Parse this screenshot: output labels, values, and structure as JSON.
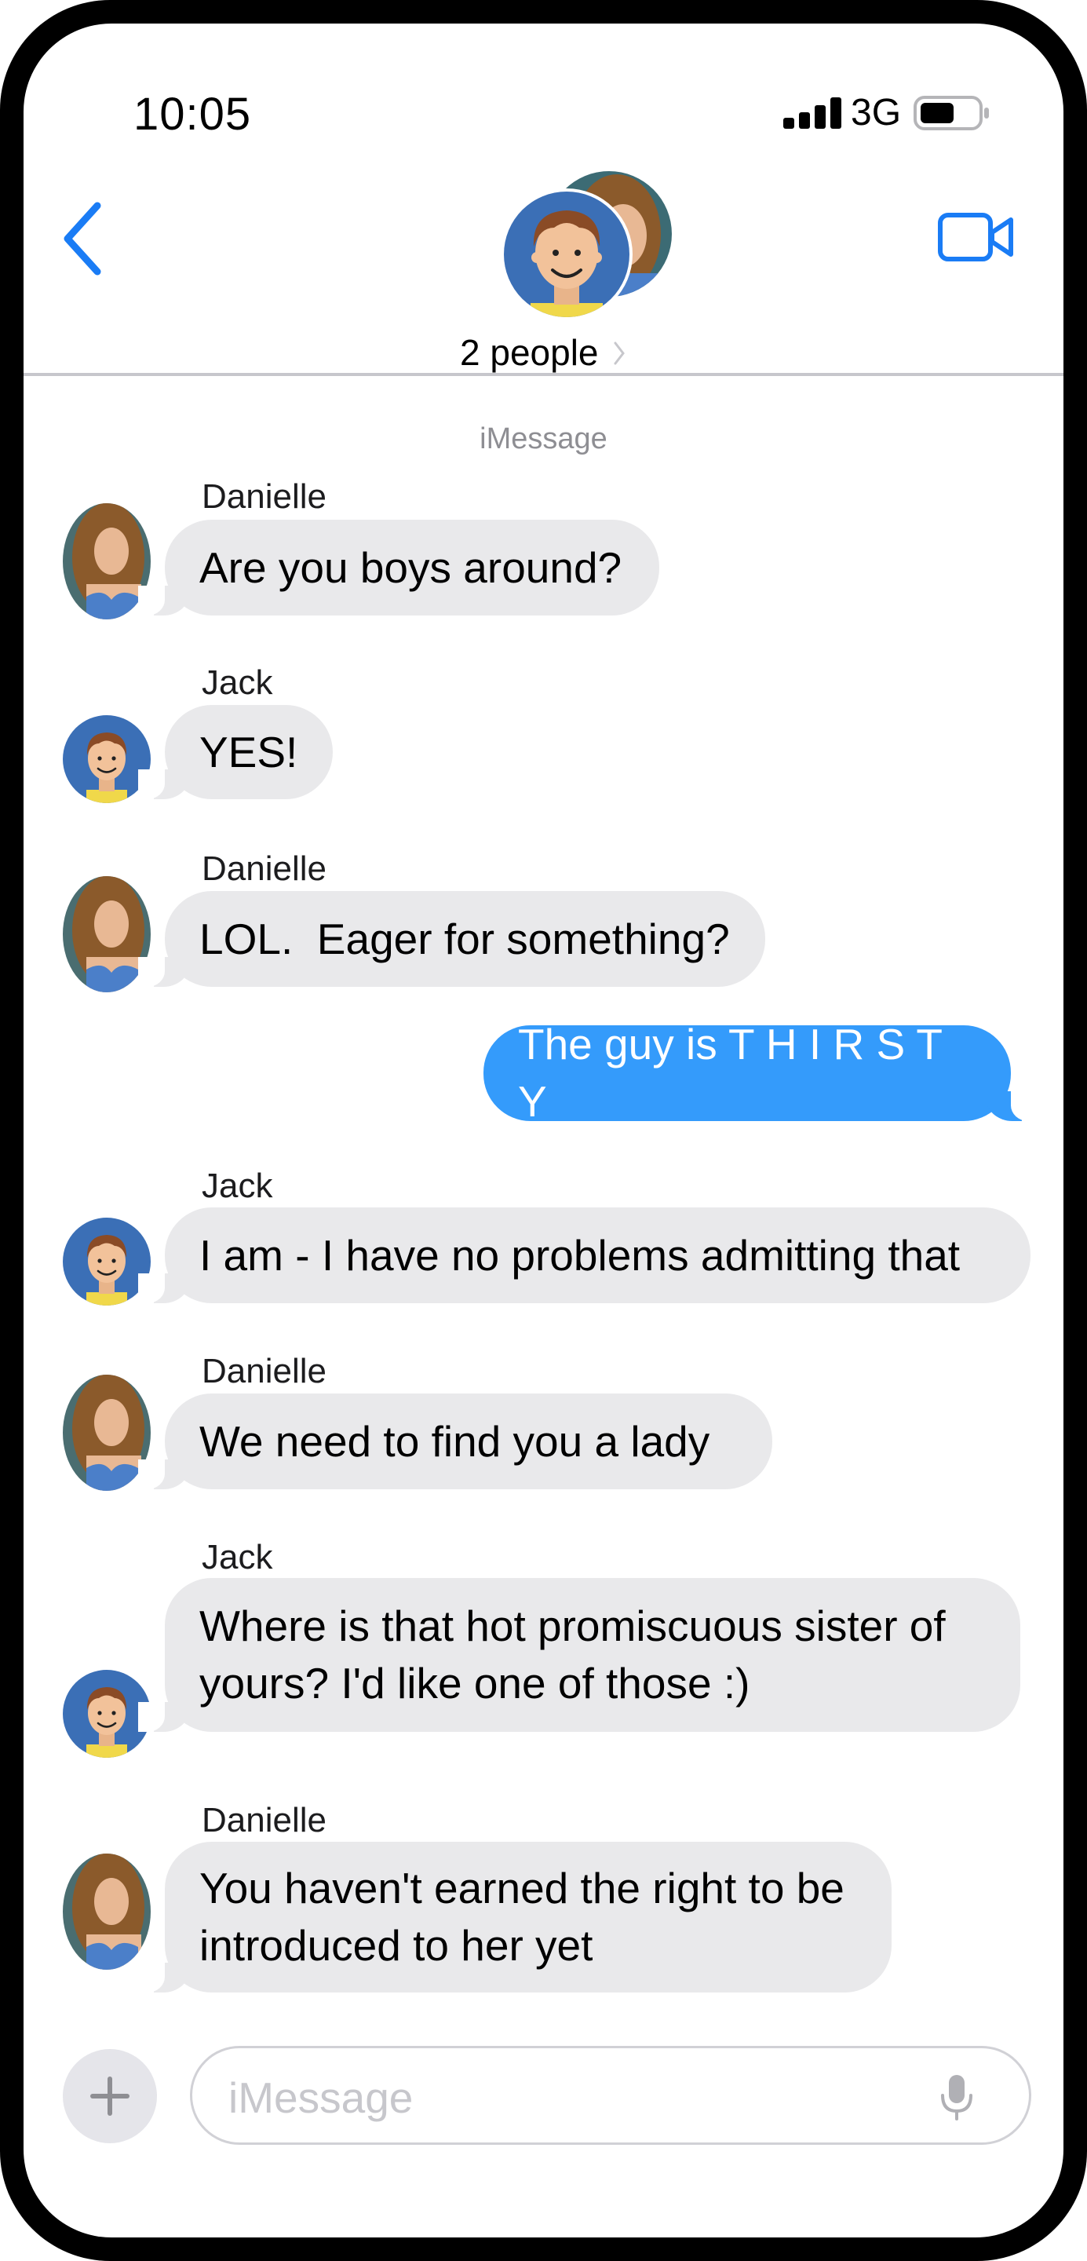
{
  "status_bar": {
    "time": "10:05",
    "carrier": "3G",
    "icons": [
      "signal-bars-icon",
      "battery-icon"
    ]
  },
  "header": {
    "participants_label": "2 people",
    "icons": [
      "back-chevron-icon",
      "video-camera-icon",
      "chevron-right-icon"
    ]
  },
  "conversation": {
    "service_label": "iMessage",
    "messages": [
      {
        "sender": "Danielle",
        "text": "Are you boys around?",
        "direction": "incoming"
      },
      {
        "sender": "Jack",
        "text": "YES!",
        "direction": "incoming"
      },
      {
        "sender": "Danielle",
        "text": "LOL.  Eager for something?",
        "direction": "incoming"
      },
      {
        "sender": "",
        "text": "The guy is T H I R S T Y",
        "direction": "outgoing"
      },
      {
        "sender": "Jack",
        "text": "I am - I have no problems admitting that",
        "direction": "incoming"
      },
      {
        "sender": "Danielle",
        "text": "We need to find you a lady",
        "direction": "incoming"
      },
      {
        "sender": "Jack",
        "text": "Where is that hot promiscuous sister of yours? I'd like one of those :)",
        "direction": "incoming"
      },
      {
        "sender": "Danielle",
        "text": "You haven't earned the right to be introduced to her yet",
        "direction": "incoming"
      }
    ]
  },
  "composer": {
    "placeholder": "iMessage",
    "icons": [
      "plus-icon",
      "microphone-icon"
    ]
  },
  "colors": {
    "outgoing_bubble": "#349bfb",
    "incoming_bubble": "#e9e9eb",
    "accent": "#1a7cf5"
  }
}
